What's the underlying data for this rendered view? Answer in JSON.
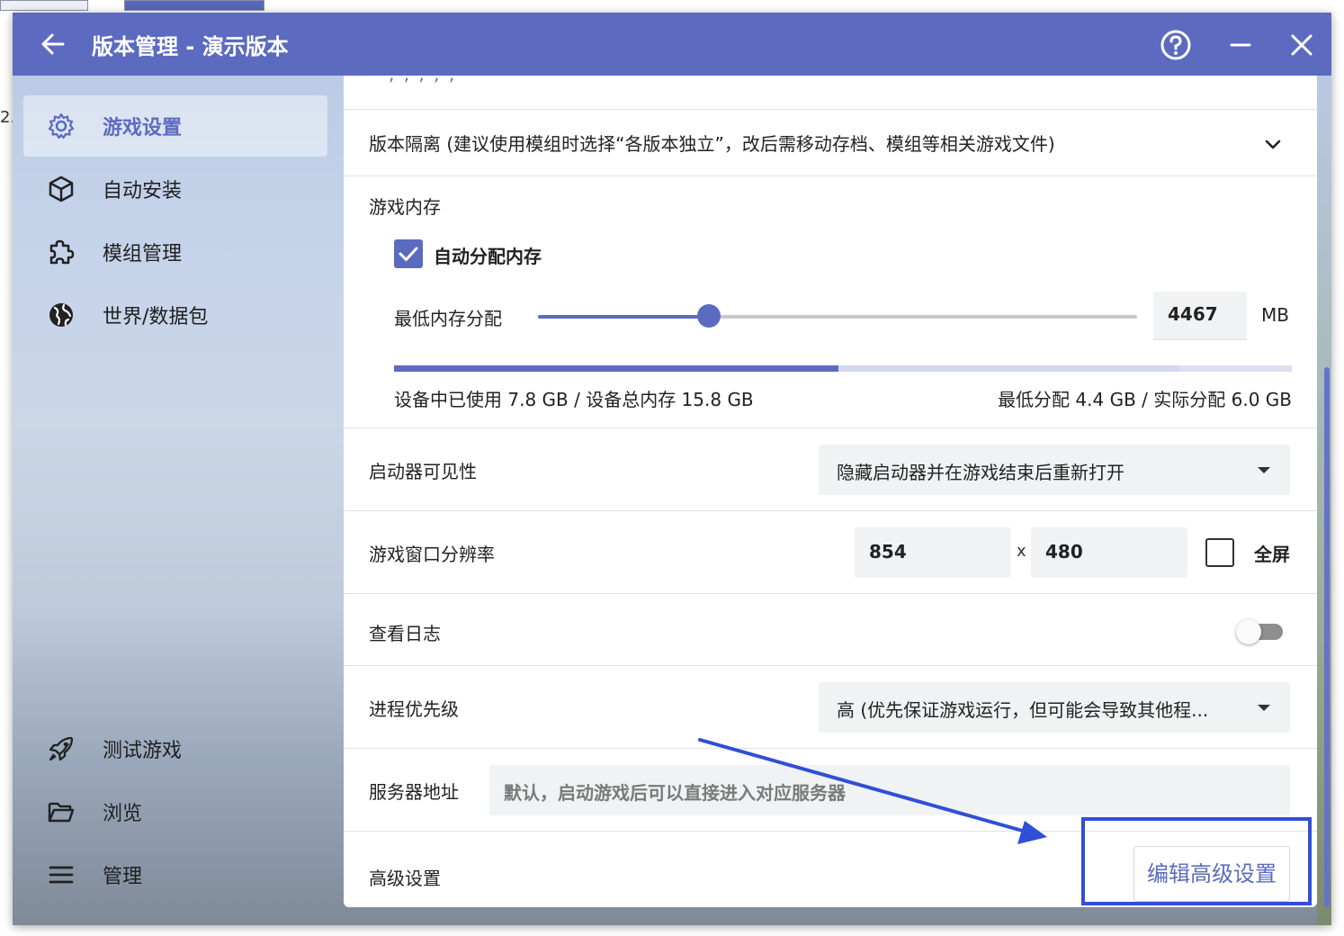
{
  "window": {
    "title": "版本管理 - 演示版本",
    "accent_color": "#5c6bc0",
    "buttons": {
      "back": "arrow-left-icon",
      "help": "help-icon",
      "minimize": "minimize-icon",
      "close": "close-icon"
    }
  },
  "background": {
    "peek_text": "2."
  },
  "sidebar": {
    "items": [
      {
        "label": "游戏设置",
        "icon": "gear-icon",
        "active": true
      },
      {
        "label": "自动安装",
        "icon": "cube-icon",
        "active": false
      },
      {
        "label": "模组管理",
        "icon": "puzzle-icon",
        "active": false
      },
      {
        "label": "世界/数据包",
        "icon": "globe-icon",
        "active": false
      }
    ],
    "bottom_items": [
      {
        "label": "测试游戏",
        "icon": "rocket-icon"
      },
      {
        "label": "浏览",
        "icon": "folder-icon"
      },
      {
        "label": "管理",
        "icon": "menu-icon"
      }
    ]
  },
  "settings": {
    "isolation": {
      "label": "版本隔离 (建议使用模组时选择“各版本独立”，改后需移动存档、模组等相关游戏文件)"
    },
    "memory": {
      "title": "游戏内存",
      "auto_label": "自动分配内存",
      "auto_checked": true,
      "min_label": "最低内存分配",
      "min_value": "4467",
      "unit": "MB",
      "slider_fraction": 0.285,
      "used_fraction": 0.495,
      "alloc_fraction": 0.38,
      "usage_text": "设备中已使用 7.8 GB / 设备总内存 15.8 GB",
      "alloc_text": "最低分配 4.4 GB / 实际分配 6.0 GB"
    },
    "launcher_visibility": {
      "label": "启动器可见性",
      "value": "隐藏启动器并在游戏结束后重新打开"
    },
    "resolution": {
      "label": "游戏窗口分辨率",
      "width": "854",
      "separator": "x",
      "height": "480",
      "fullscreen_label": "全屏",
      "fullscreen_checked": false
    },
    "log": {
      "label": "查看日志",
      "enabled": false
    },
    "priority": {
      "label": "进程优先级",
      "value": "高 (优先保证游戏运行，但可能会导致其他程..."
    },
    "server": {
      "label": "服务器地址",
      "placeholder": "默认，启动游戏后可以直接进入对应服务器"
    },
    "advanced": {
      "label": "高级设置",
      "button_label": "编辑高级设置"
    }
  },
  "annotation": {
    "color": "#2f4fd8"
  }
}
